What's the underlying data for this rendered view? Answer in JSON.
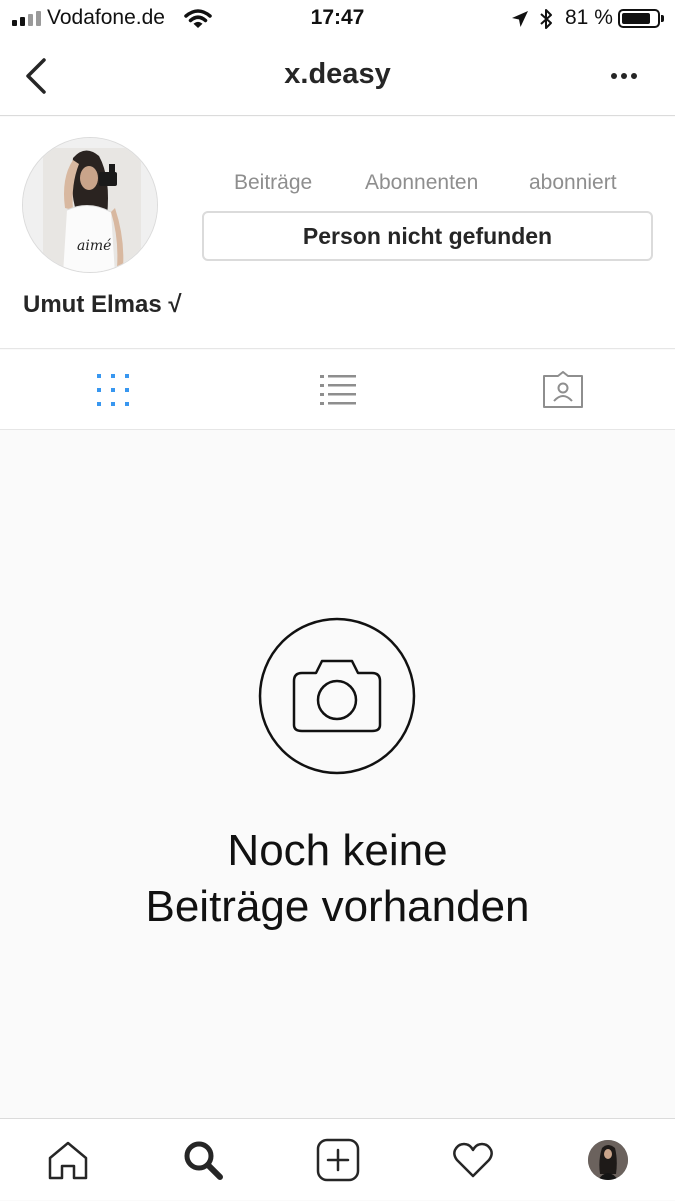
{
  "status_bar": {
    "carrier": "Vodafone.de",
    "time": "17:47",
    "battery_text": "81 %",
    "battery_level": 0.81
  },
  "header": {
    "title": "x.deasy",
    "back_icon": "chevron-left-icon",
    "more_icon": "more-horizontal-icon"
  },
  "profile": {
    "stats": [
      {
        "label": "Beiträge"
      },
      {
        "label": "Abonnenten"
      },
      {
        "label": "abonniert"
      }
    ],
    "button_label": "Person nicht gefunden",
    "name": "Umut Elmas √",
    "avatar_shirt_text": "aimé"
  },
  "tabs": [
    {
      "icon": "grid-icon",
      "active": true
    },
    {
      "icon": "list-icon",
      "active": false
    },
    {
      "icon": "tagged-icon",
      "active": false
    }
  ],
  "empty_state": {
    "icon": "camera-icon",
    "line1": "Noch keine",
    "line2": "Beiträge vorhanden"
  },
  "bottom_nav": [
    {
      "icon": "home-icon"
    },
    {
      "icon": "search-icon",
      "active": true
    },
    {
      "icon": "add-post-icon"
    },
    {
      "icon": "heart-icon"
    },
    {
      "icon": "profile-avatar-icon"
    }
  ],
  "colors": {
    "accent_blue": "#3897f0",
    "text": "#262626",
    "muted": "#8e8e8e",
    "border": "#dbdbdb"
  }
}
